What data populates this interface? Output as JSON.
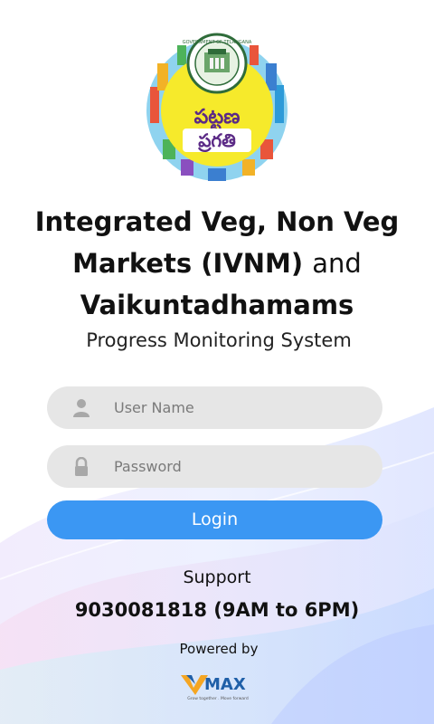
{
  "logo": {
    "icon": "telangana-pattana-pragathi-logo",
    "emblem_text": "GOVERNMENT OF TELANGANA",
    "telugu_line1": "పట్టణ",
    "telugu_line2": "ప్రగతి"
  },
  "heading": {
    "line1": "Integrated Veg, Non Veg",
    "line2_bold": "Markets (IVNM)",
    "line2_plain": "and",
    "line3": "Vaikuntadhamams"
  },
  "subtitle": "Progress Monitoring System",
  "form": {
    "username": {
      "placeholder": "User Name",
      "value": "",
      "icon": "user-icon"
    },
    "password": {
      "placeholder": "Password",
      "value": "",
      "icon": "lock-icon"
    },
    "login_label": "Login"
  },
  "support": {
    "label": "Support",
    "phone": "9030081818 (9AM to 6PM)"
  },
  "footer": {
    "powered_by": "Powered by",
    "brand_name": "MAX",
    "brand_tagline": "Grow together . Move forward"
  },
  "colors": {
    "primary": "#3b97f3",
    "field_bg": "#e6e6e6",
    "text": "#111111",
    "logo_yellow": "#f6ea2b",
    "logo_purple": "#5b2a86",
    "brand_blue": "#1f5fa8"
  }
}
